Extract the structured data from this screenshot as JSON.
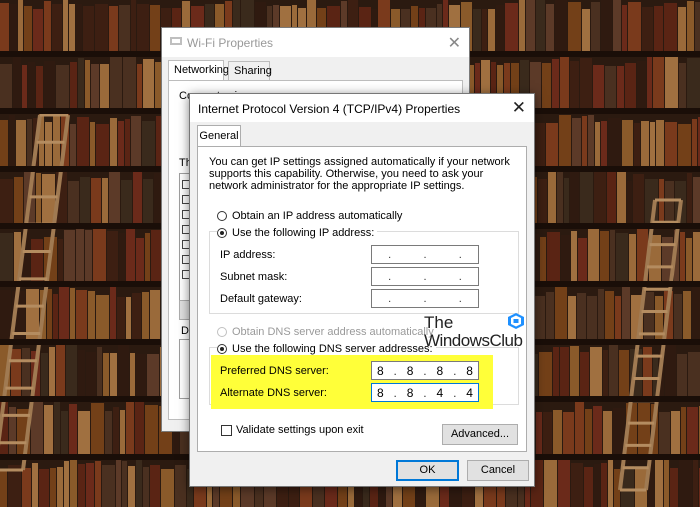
{
  "wifi_window": {
    "title": "Wi-Fi Properties",
    "tabs": [
      {
        "label": "Networking",
        "active": true
      },
      {
        "label": "Sharing",
        "active": false
      }
    ],
    "connect_using_label": "Connect using:",
    "list_label_fragment": "Th",
    "description_label_fragment": "D",
    "close_icon": "close-icon"
  },
  "dialog": {
    "title": "Internet Protocol Version 4 (TCP/IPv4) Properties",
    "tab": "General",
    "intro": "You can get IP settings assigned automatically if your network supports this capability. Otherwise, you need to ask your network administrator for the appropriate IP settings.",
    "ip": {
      "auto_label": "Obtain an IP address automatically",
      "manual_label": "Use the following IP address:",
      "selected": "manual",
      "fields": [
        {
          "label": "IP address:",
          "value": "   .   .   ."
        },
        {
          "label": "Subnet mask:",
          "value": "   .   .   ."
        },
        {
          "label": "Default gateway:",
          "value": "   .   .   ."
        }
      ]
    },
    "dns": {
      "auto_label": "Obtain DNS server address automatically",
      "manual_label": "Use the following DNS server addresses:",
      "selected": "manual",
      "preferred_label": "Preferred DNS server:",
      "preferred_octets": [
        "8",
        "8",
        "8",
        "8"
      ],
      "alternate_label": "Alternate DNS server:",
      "alternate_octets": [
        "8",
        "8",
        "4",
        "4"
      ],
      "highlight_color": "#ffff39"
    },
    "validate_label": "Validate settings upon exit",
    "validate_checked": false,
    "advanced_button": "Advanced...",
    "ok_button": "OK",
    "cancel_button": "Cancel",
    "accent_color": "#0078d7"
  },
  "watermark": {
    "line1": "The",
    "line2": "WindowsClub",
    "logo_color": "#1e90ff"
  }
}
